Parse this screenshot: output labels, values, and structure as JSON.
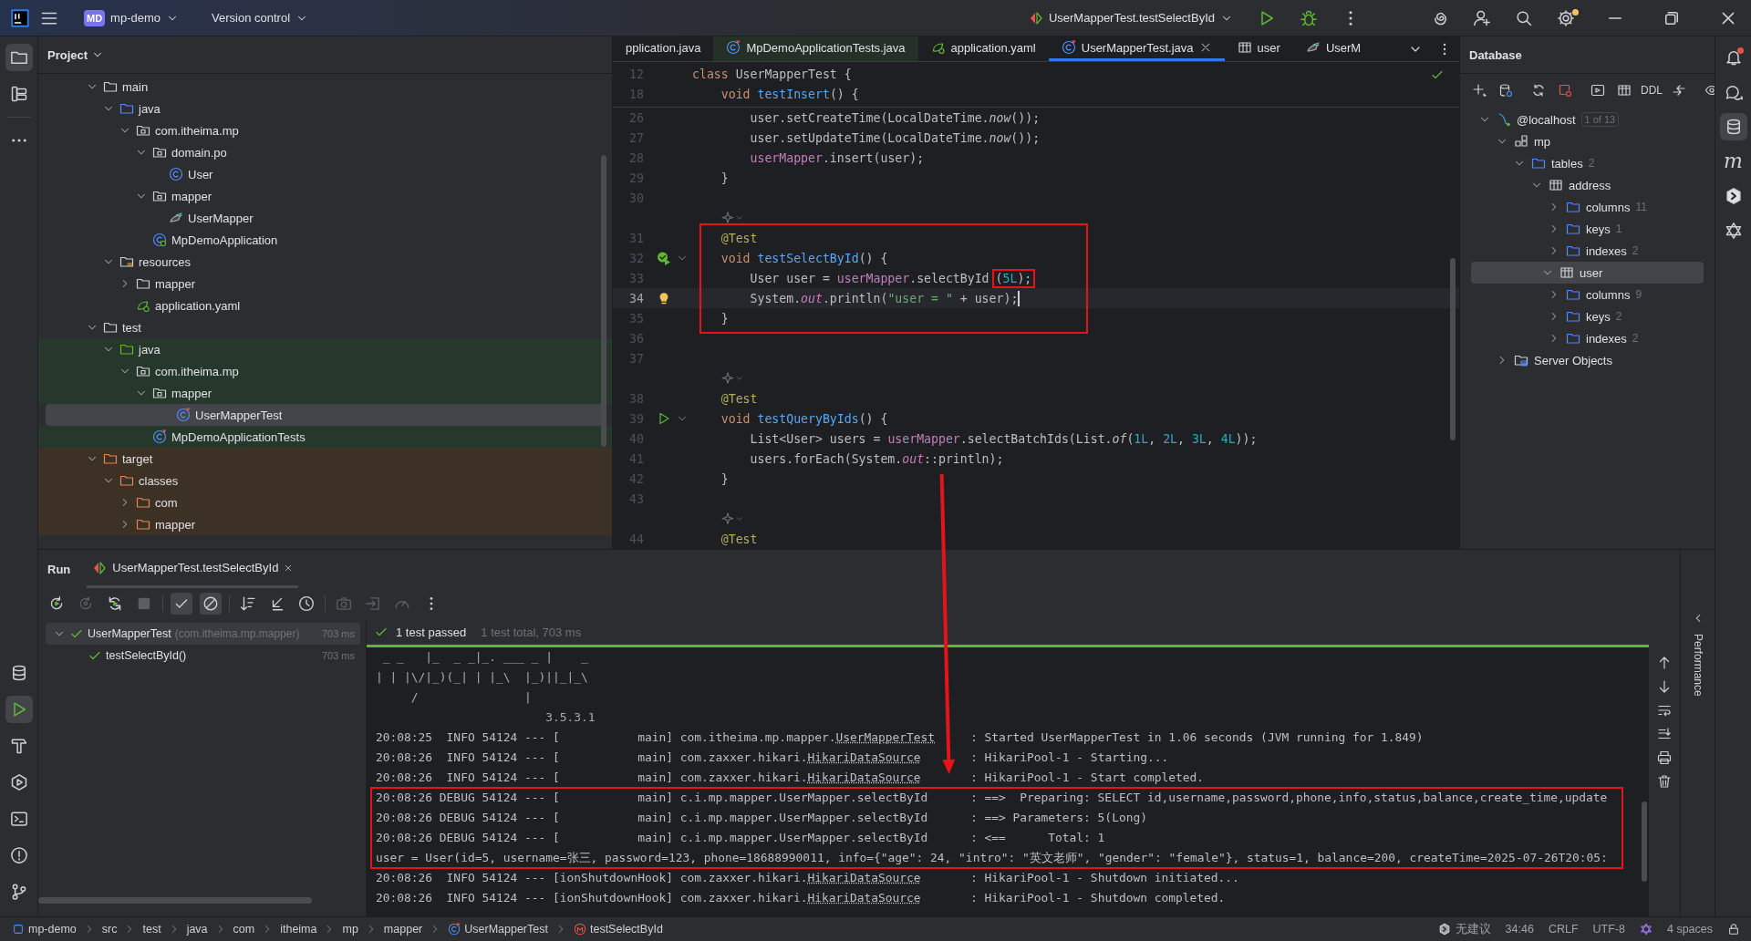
{
  "title_bar": {
    "badge": "MD",
    "project": "mp-demo",
    "vcs": "Version control",
    "run_config": "UserMapperTest.testSelectById",
    "settings_badge": true
  },
  "left_strip": [
    {
      "kind": "folder",
      "selected": true
    },
    {
      "kind": "structure",
      "selected": false
    },
    {
      "kind": "more",
      "selected": false
    }
  ],
  "left_strip_bottom": [
    {
      "kind": "database",
      "selected": false
    },
    {
      "kind": "run",
      "selected": true
    },
    {
      "kind": "hammer",
      "selected": false
    },
    {
      "kind": "services",
      "selected": false
    },
    {
      "kind": "terminal",
      "selected": false
    },
    {
      "kind": "problems",
      "selected": false
    },
    {
      "kind": "git",
      "selected": false
    }
  ],
  "project": {
    "title": "Project",
    "tree": [
      {
        "label": "main",
        "kind": "folder",
        "expanded": true,
        "selected": false,
        "children": [
          {
            "label": "java",
            "kind": "folder-src",
            "expanded": true,
            "selected": false,
            "children": [
              {
                "label": "com.itheima.mp",
                "kind": "package",
                "expanded": true,
                "selected": false,
                "children": [
                  {
                    "label": "domain.po",
                    "kind": "package",
                    "expanded": true,
                    "selected": false,
                    "children": [
                      {
                        "label": "User",
                        "kind": "class",
                        "selected": false
                      }
                    ]
                  },
                  {
                    "label": "mapper",
                    "kind": "package",
                    "expanded": true,
                    "selected": false,
                    "children": [
                      {
                        "label": "UserMapper",
                        "kind": "mapper",
                        "selected": false
                      }
                    ]
                  },
                  {
                    "label": "MpDemoApplication",
                    "kind": "spring",
                    "selected": false
                  }
                ]
              }
            ]
          },
          {
            "label": "resources",
            "kind": "resources",
            "expanded": true,
            "selected": false,
            "children": [
              {
                "label": "mapper",
                "kind": "folder",
                "expanded": false,
                "selected": false
              },
              {
                "label": "application.yaml",
                "kind": "yaml",
                "selected": false
              }
            ]
          }
        ]
      },
      {
        "label": "test",
        "kind": "folder",
        "expanded": true,
        "selected": false,
        "children": [
          {
            "label": "java",
            "kind": "folder-test",
            "expanded": true,
            "selected": false,
            "children": [
              {
                "label": "com.itheima.mp",
                "kind": "package",
                "expanded": true,
                "selected": false,
                "children": [
                  {
                    "label": "mapper",
                    "kind": "package",
                    "expanded": true,
                    "selected": false,
                    "children": [
                      {
                        "label": "UserMapperTest",
                        "kind": "testclass",
                        "selected": true
                      }
                    ]
                  },
                  {
                    "label": "MpDemoApplicationTests",
                    "kind": "testclass",
                    "selected": false
                  }
                ]
              }
            ]
          }
        ]
      },
      {
        "label": "target",
        "kind": "folder-excl",
        "expanded": true,
        "selected": false,
        "children": [
          {
            "label": "classes",
            "kind": "folder-excl",
            "expanded": true,
            "selected": false,
            "children": [
              {
                "label": "com",
                "kind": "folder-excl",
                "expanded": false,
                "selected": false
              },
              {
                "label": "mapper",
                "kind": "folder-excl",
                "expanded": false,
                "selected": false
              }
            ]
          }
        ]
      }
    ]
  },
  "editor": {
    "tabs": [
      {
        "label": "pplication.java",
        "selected": false
      },
      {
        "label": "MpDemoApplicationTests.java",
        "kind": "testclass",
        "selected": false
      },
      {
        "label": "application.yaml",
        "kind": "yaml",
        "selected": false
      },
      {
        "label": "UserMapperTest.java",
        "kind": "testclass",
        "selected": true,
        "closable": true
      },
      {
        "label": "user",
        "kind": "table",
        "selected": false
      },
      {
        "label": "UserM",
        "kind": "mapper",
        "selected": false
      }
    ],
    "inspection_ok": true,
    "sticky_lines": [
      {
        "number": "12",
        "tokens": [
          {
            "t": "class",
            "kind": "kw"
          },
          {
            "t": " UserMapperTest {"
          }
        ]
      },
      {
        "number": "18",
        "tokens": [
          {
            "t": "    void",
            "kind": "kw"
          },
          {
            "t": " testInsert",
            "kind": "fn"
          },
          {
            "t": "() {"
          }
        ]
      }
    ],
    "lines": [
      {
        "kind": "code",
        "number": "26",
        "tokens": [
          {
            "t": "        user.setCreateTime(LocalDateTime."
          },
          {
            "t": "now",
            "kind": "it"
          },
          {
            "t": "());"
          }
        ]
      },
      {
        "kind": "code",
        "number": "27",
        "tokens": [
          {
            "t": "        user.setUpdateTime(LocalDateTime."
          },
          {
            "t": "now",
            "kind": "it"
          },
          {
            "t": "());"
          }
        ]
      },
      {
        "kind": "code",
        "number": "28",
        "tokens": [
          {
            "t": "        userMapper",
            "kind": "field"
          },
          {
            "t": ".insert(user);"
          }
        ]
      },
      {
        "kind": "code",
        "number": "29",
        "tokens": [
          {
            "t": "    }"
          }
        ]
      },
      {
        "kind": "code",
        "number": "30"
      },
      {
        "kind": "hint"
      },
      {
        "kind": "code",
        "number": "31",
        "framed": true,
        "tokens": [
          {
            "t": "    @Test",
            "kind": "ann"
          }
        ]
      },
      {
        "kind": "code",
        "number": "32",
        "framed": true,
        "runnable": true,
        "test_passed": true,
        "fold": true,
        "tokens": [
          {
            "t": "    void",
            "kind": "kw"
          },
          {
            "t": " testSelectById",
            "kind": "fn"
          },
          {
            "t": "() {"
          }
        ]
      },
      {
        "kind": "code",
        "number": "33",
        "framed": true,
        "tokens": [
          {
            "t": "        User user = "
          },
          {
            "t": "userMapper",
            "kind": "field"
          },
          {
            "t": ".selectById"
          },
          {
            "t": "(",
            "boxed": true
          },
          {
            "t": "5L",
            "kind": "num",
            "boxed": true
          },
          {
            "t": ");",
            "boxed": true
          }
        ]
      },
      {
        "kind": "code",
        "number": "34",
        "framed": true,
        "current": true,
        "intention_bulb": true,
        "tokens": [
          {
            "t": "        System."
          },
          {
            "t": "out",
            "kind": "sfield"
          },
          {
            "t": ".println("
          },
          {
            "t": "\"user = \"",
            "kind": "str"
          },
          {
            "t": " + user);"
          }
        ]
      },
      {
        "kind": "code",
        "number": "35",
        "framed": true,
        "tokens": [
          {
            "t": "    }"
          }
        ]
      },
      {
        "kind": "code",
        "number": "36"
      },
      {
        "kind": "code",
        "number": "37"
      },
      {
        "kind": "hint"
      },
      {
        "kind": "code",
        "number": "38",
        "tokens": [
          {
            "t": "    @Test",
            "kind": "ann"
          }
        ]
      },
      {
        "kind": "code",
        "number": "39",
        "runnable": true,
        "test_passed": false,
        "fold": true,
        "tokens": [
          {
            "t": "    void",
            "kind": "kw"
          },
          {
            "t": " testQueryByIds",
            "kind": "fn"
          },
          {
            "t": "() {"
          }
        ]
      },
      {
        "kind": "code",
        "number": "40",
        "tokens": [
          {
            "t": "        List<User> users = "
          },
          {
            "t": "userMapper",
            "kind": "field"
          },
          {
            "t": ".selectBatchIds(List."
          },
          {
            "t": "of",
            "kind": "it"
          },
          {
            "t": "("
          },
          {
            "t": "1L",
            "kind": "num"
          },
          {
            "t": ", "
          },
          {
            "t": "2L",
            "kind": "num"
          },
          {
            "t": ", "
          },
          {
            "t": "3L",
            "kind": "num"
          },
          {
            "t": ", "
          },
          {
            "t": "4L",
            "kind": "num"
          },
          {
            "t": "));"
          }
        ]
      },
      {
        "kind": "code",
        "number": "41",
        "tokens": [
          {
            "t": "        users.forEach(System."
          },
          {
            "t": "out",
            "kind": "sfield"
          },
          {
            "t": "::println);"
          }
        ]
      },
      {
        "kind": "code",
        "number": "42",
        "tokens": [
          {
            "t": "    }"
          }
        ]
      },
      {
        "kind": "code",
        "number": "43"
      },
      {
        "kind": "hint"
      },
      {
        "kind": "code",
        "number": "44",
        "tokens": [
          {
            "t": "    @Test",
            "kind": "ann"
          }
        ]
      }
    ]
  },
  "database": {
    "title": "Database",
    "toolbar": [
      {
        "kind": "add"
      },
      {
        "kind": "db-settings"
      },
      {
        "kind": "sep"
      },
      {
        "kind": "refresh"
      },
      {
        "kind": "disconnect"
      },
      {
        "kind": "sep"
      },
      {
        "kind": "console"
      },
      {
        "kind": "table"
      },
      {
        "kind": "text",
        "label": "DDL"
      },
      {
        "kind": "compare"
      },
      {
        "kind": "sep"
      },
      {
        "kind": "eye"
      }
    ],
    "tree": [
      {
        "label": "@localhost",
        "kind": "connection",
        "badge": "1 of 13",
        "expanded": true,
        "selected": false,
        "children": [
          {
            "label": "mp",
            "kind": "schema",
            "expanded": true,
            "selected": false,
            "children": [
              {
                "label": "tables",
                "kind": "folder-src",
                "count": "2",
                "expanded": true,
                "selected": false,
                "children": [
                  {
                    "label": "address",
                    "kind": "table",
                    "expanded": true,
                    "selected": false,
                    "children": [
                      {
                        "label": "columns",
                        "kind": "folder-src",
                        "count": "11",
                        "expanded": false,
                        "selected": false
                      },
                      {
                        "label": "keys",
                        "kind": "folder-src",
                        "count": "1",
                        "expanded": false,
                        "selected": false
                      },
                      {
                        "label": "indexes",
                        "kind": "folder-src",
                        "count": "2",
                        "expanded": false,
                        "selected": false
                      }
                    ]
                  },
                  {
                    "label": "user",
                    "kind": "table",
                    "expanded": true,
                    "selected": true,
                    "children": [
                      {
                        "label": "columns",
                        "kind": "folder-src",
                        "count": "9",
                        "expanded": false,
                        "selected": false
                      },
                      {
                        "label": "keys",
                        "kind": "folder-src",
                        "count": "2",
                        "expanded": false,
                        "selected": false
                      },
                      {
                        "label": "indexes",
                        "kind": "folder-src",
                        "count": "2",
                        "expanded": false,
                        "selected": false
                      }
                    ]
                  }
                ]
              }
            ]
          },
          {
            "label": "Server Objects",
            "kind": "server",
            "expanded": false,
            "selected": false
          }
        ]
      }
    ]
  },
  "right_strip": [
    {
      "kind": "bell",
      "badge": true,
      "selected": false
    },
    {
      "kind": "chat",
      "selected": false
    },
    {
      "kind": "database",
      "selected": true
    },
    {
      "kind": "glyph",
      "glyph": "m",
      "selected": false
    },
    {
      "kind": "hexagon",
      "selected": false
    },
    {
      "kind": "hexagram",
      "selected": false
    }
  ],
  "run": {
    "title": "Run",
    "tabs": [
      {
        "label": "UserMapperTest.testSelectById",
        "selected": true
      }
    ],
    "toolbar": [
      {
        "kind": "rerun",
        "disabled": false,
        "toggled": false
      },
      {
        "kind": "rerun-failed",
        "disabled": true,
        "toggled": false
      },
      {
        "kind": "auto-test",
        "disabled": false,
        "toggled": false
      },
      {
        "kind": "stop",
        "disabled": true,
        "toggled": false
      },
      {
        "kind": "sep"
      },
      {
        "kind": "show-passed",
        "disabled": false,
        "toggled": true
      },
      {
        "kind": "show-ignored",
        "disabled": false,
        "toggled": true
      },
      {
        "kind": "sep"
      },
      {
        "kind": "sort",
        "disabled": false,
        "toggled": false
      },
      {
        "kind": "collapse",
        "disabled": false,
        "toggled": false
      },
      {
        "kind": "history",
        "disabled": false,
        "toggled": false
      },
      {
        "kind": "sep"
      },
      {
        "kind": "camera",
        "disabled": true,
        "toggled": false
      },
      {
        "kind": "import",
        "disabled": true,
        "toggled": false
      },
      {
        "kind": "gauge",
        "disabled": true,
        "toggled": false
      },
      {
        "kind": "more",
        "disabled": false,
        "toggled": false
      }
    ],
    "tests": [
      {
        "label": "UserMapperTest",
        "package": "(com.itheima.mp.mapper)",
        "time": "703 ms",
        "passed": true,
        "expanded": true,
        "selected": true,
        "children": [
          {
            "label": "testSelectById()",
            "time": "703 ms",
            "passed": true,
            "selected": false
          }
        ]
      }
    ],
    "summary": {
      "status": "1 test passed",
      "detail": "1 test total, 703 ms",
      "passed": true,
      "level": 1
    },
    "console": [
      {
        "kind": "banner",
        "tokens": [
          {
            "t": " _ _   |_  _ _|_. ___ _ |    _"
          }
        ]
      },
      {
        "kind": "banner",
        "tokens": [
          {
            "t": "| | |\\/|_)(_| | |_\\  |_)||_|_\\"
          }
        ]
      },
      {
        "kind": "banner",
        "tokens": [
          {
            "t": "     /               |"
          }
        ]
      },
      {
        "kind": "banner",
        "tokens": [
          {
            "t": "                        3.5.3.1"
          }
        ]
      },
      {
        "kind": "log",
        "tokens": [
          {
            "t": "20:08:25  INFO 54124 --- [           main] com.itheima.mp.mapper."
          },
          {
            "t": "UserMapperTest",
            "kind": "link"
          },
          {
            "t": "     : Started UserMapperTest in 1.06 seconds (JVM running for 1.849)"
          }
        ]
      },
      {
        "kind": "log",
        "tokens": [
          {
            "t": "20:08:26  INFO 54124 --- [           main] com.zaxxer.hikari."
          },
          {
            "t": "HikariDataSource",
            "kind": "link"
          },
          {
            "t": "       : HikariPool-1 - Starting..."
          }
        ]
      },
      {
        "kind": "log",
        "tokens": [
          {
            "t": "20:08:26  INFO 54124 --- [           main] com.zaxxer.hikari."
          },
          {
            "t": "HikariDataSource",
            "kind": "link"
          },
          {
            "t": "       : HikariPool-1 - Start completed."
          }
        ]
      },
      {
        "kind": "log",
        "framed": true,
        "tokens": [
          {
            "t": "20:08:26 DEBUG 54124 --- [           main] c.i.mp.mapper.UserMapper.selectById      : ==>  Preparing: SELECT id,username,password,phone,info,status,balance,create_time,update"
          }
        ]
      },
      {
        "kind": "log",
        "framed": true,
        "tokens": [
          {
            "t": "20:08:26 DEBUG 54124 --- [           main] c.i.mp.mapper.UserMapper.selectById      : ==> Parameters: 5(Long)"
          }
        ]
      },
      {
        "kind": "log",
        "framed": true,
        "tokens": [
          {
            "t": "20:08:26 DEBUG 54124 --- [           main] c.i.mp.mapper.UserMapper.selectById      : <==      Total: 1"
          }
        ]
      },
      {
        "kind": "output",
        "framed": true,
        "tokens": [
          {
            "t": "user = User(id=5, username=张三, password=123, phone=18688990011, info={\"age\": 24, \"intro\": \"英文老师\", \"gender\": \"female\"}, status=1, balance=200, createTime=2025-07-26T20:05:"
          }
        ]
      },
      {
        "kind": "log",
        "tokens": [
          {
            "t": "20:08:26  INFO 54124 --- [ionShutdownHook] com.zaxxer.hikari."
          },
          {
            "t": "HikariDataSource",
            "kind": "link"
          },
          {
            "t": "       : HikariPool-1 - Shutdown initiated..."
          }
        ]
      },
      {
        "kind": "log",
        "tokens": [
          {
            "t": "20:08:26  INFO 54124 --- [ionShutdownHook] com.zaxxer.hikari."
          },
          {
            "t": "HikariDataSource",
            "kind": "link"
          },
          {
            "t": "       : HikariPool-1 - Shutdown completed."
          }
        ]
      }
    ],
    "side_tools": [
      {
        "kind": "arrow-up"
      },
      {
        "kind": "arrow-down"
      },
      {
        "kind": "wrap"
      },
      {
        "kind": "scroll-end"
      },
      {
        "kind": "print"
      },
      {
        "kind": "trash"
      }
    ],
    "performance": "Performance"
  },
  "annotation_arrow": true,
  "status_bar": {
    "breadcrumbs": [
      {
        "label": "mp-demo",
        "kind": "module"
      },
      {
        "label": "src"
      },
      {
        "label": "test"
      },
      {
        "label": "java"
      },
      {
        "label": "com"
      },
      {
        "label": "itheima"
      },
      {
        "label": "mp"
      },
      {
        "label": "mapper"
      },
      {
        "label": "UserMapperTest",
        "kind": "testclass"
      },
      {
        "label": "testSelectById",
        "kind": "method"
      }
    ],
    "items": [
      {
        "kind": "ai",
        "label": "无建议"
      },
      {
        "kind": "text",
        "label": "34:46"
      },
      {
        "kind": "text",
        "label": "CRLF"
      },
      {
        "kind": "text",
        "label": "UTF-8"
      },
      {
        "kind": "hexagram"
      },
      {
        "kind": "text",
        "label": "4 spaces"
      },
      {
        "kind": "lock"
      }
    ]
  }
}
